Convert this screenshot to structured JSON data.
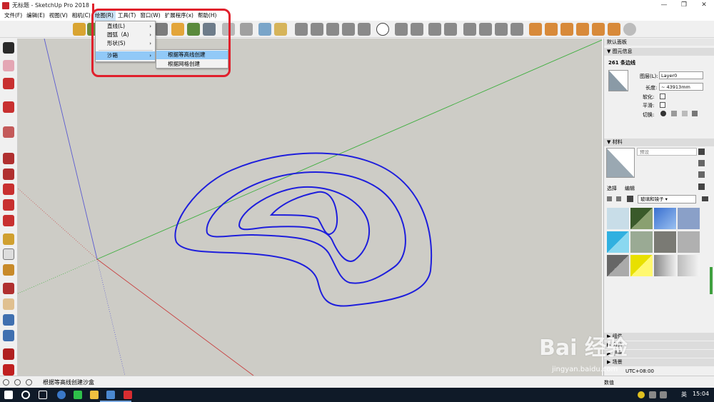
{
  "window": {
    "title": "无标题 - SketchUp Pro 2018",
    "min": "—",
    "max": "❐",
    "close": "✕"
  },
  "menubar": [
    "文件(F)",
    "编辑(E)",
    "视图(V)",
    "相机(C)",
    "绘图(R)",
    "工具(T)",
    "窗口(W)",
    "扩展程序(x)",
    "帮助(H)"
  ],
  "draw_menu": {
    "items": [
      "直线(L)",
      "圆弧（A)",
      "形状(S)",
      "沙箱"
    ],
    "arrow": "›"
  },
  "sandbox_submenu": {
    "items": [
      "根据等高线创建",
      "根据网格创建"
    ]
  },
  "panel": {
    "title": "默认面板",
    "entity_info": {
      "header": "图元信息",
      "entity": "261 条边线",
      "layer_label": "图层(L):",
      "layer_value": "Layer0",
      "length_label": "长度:",
      "length_value": "~ 43913mm",
      "soft_label": "软化:",
      "smooth_label": "平滑:",
      "toggle_label": "切换:"
    },
    "materials": {
      "header": "材料",
      "preview_label": "预设",
      "tab_select": "选择",
      "tab_edit": "编辑",
      "library": "玻璃和镜子"
    },
    "collapsed": [
      "组件",
      "风格",
      "图层",
      "场景"
    ],
    "shadow_time": "UTC+08:00"
  },
  "status": {
    "text": "根据等高线创建沙盒",
    "measure_label": "数值"
  },
  "taskbar": {
    "lang": "英",
    "time": "15:04"
  },
  "watermark": {
    "brand": "Bai 经验",
    "url": "jingyan.baidu.com"
  },
  "colors": {
    "contour": "#1e1edc",
    "annotation": "#e0202c",
    "viewport": "#cdccc6",
    "axis_green": "#3cae3c",
    "axis_red": "#c84040",
    "axis_blue": "#5a5ad0"
  }
}
